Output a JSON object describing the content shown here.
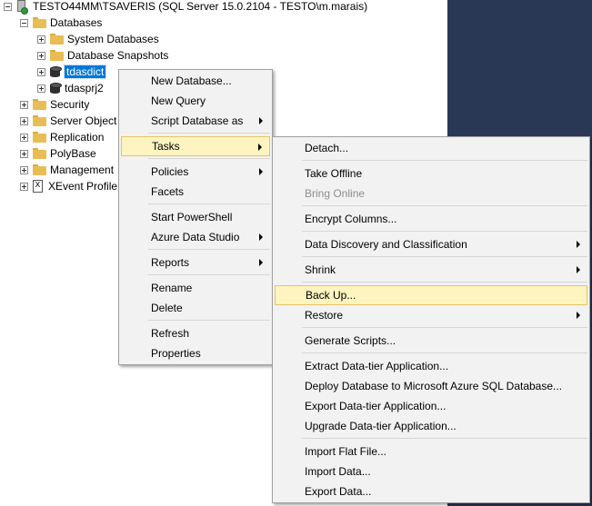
{
  "tree": {
    "server": "TESTO44MM\\TSAVERIS (SQL Server 15.0.2104 - TESTO\\m.marais)",
    "databases": "Databases",
    "system_databases": "System Databases",
    "snapshots": "Database Snapshots",
    "db1": "tdasdict",
    "db2": "tdasprj2",
    "security": "Security",
    "server_objects": "Server Object",
    "replication": "Replication",
    "polybase": "PolyBase",
    "management": "Management",
    "xevent": "XEvent Profile",
    "xevent_glyph": "X"
  },
  "context_menu": {
    "new_database": "New Database...",
    "new_query": "New Query",
    "script_database_as": "Script Database as",
    "tasks": "Tasks",
    "policies": "Policies",
    "facets": "Facets",
    "start_powershell": "Start PowerShell",
    "azure_data_studio": "Azure Data Studio",
    "reports": "Reports",
    "rename": "Rename",
    "delete": "Delete",
    "refresh": "Refresh",
    "properties": "Properties"
  },
  "tasks_menu": {
    "detach": "Detach...",
    "take_offline": "Take Offline",
    "bring_online": "Bring Online",
    "encrypt_columns": "Encrypt Columns...",
    "data_discovery": "Data Discovery and Classification",
    "shrink": "Shrink",
    "back_up": "Back Up...",
    "restore": "Restore",
    "generate_scripts": "Generate Scripts...",
    "extract_dac": "Extract Data-tier Application...",
    "deploy_azure": "Deploy Database to Microsoft Azure SQL Database...",
    "export_dac": "Export Data-tier Application...",
    "upgrade_dac": "Upgrade Data-tier Application...",
    "import_flat_file": "Import Flat File...",
    "import_data": "Import Data...",
    "export_data": "Export Data..."
  },
  "colors": {
    "highlight": "#fdf4bf",
    "selection": "#0078d7",
    "right_pane": "#293955"
  }
}
